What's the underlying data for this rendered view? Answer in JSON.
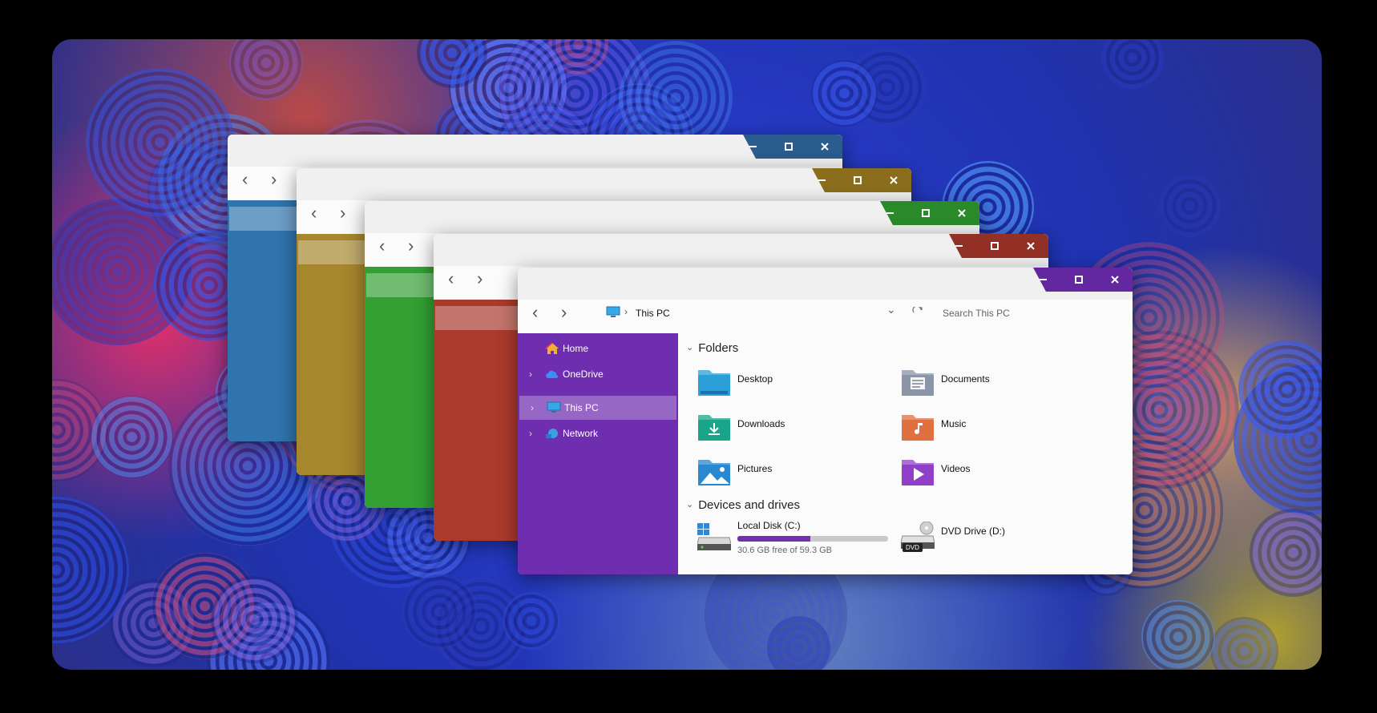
{
  "windows": [
    {
      "id": "blue",
      "accent": "#2f74ae",
      "caption": "#2b5c8f"
    },
    {
      "id": "gold",
      "accent": "#a6872e",
      "caption": "#8a6e1e"
    },
    {
      "id": "green",
      "accent": "#33a033",
      "caption": "#2a8a2a"
    },
    {
      "id": "red",
      "accent": "#a93a2c",
      "caption": "#933026"
    },
    {
      "id": "purple",
      "accent": "#6f2db0",
      "caption": "#63279f"
    }
  ],
  "caption_icons": [
    "minimize-icon",
    "maximize-icon",
    "close-icon"
  ],
  "front": {
    "address": {
      "location": "This PC",
      "chevron": "›",
      "icon": "monitor-icon"
    },
    "search": {
      "placeholder": "Search This PC",
      "icon": "refresh-icon"
    },
    "nav": {
      "back": "‹",
      "forward": "›",
      "dropdown": "⌄"
    },
    "sidebar": {
      "items": [
        {
          "label": "Home",
          "icon": "home-icon",
          "expandable": false,
          "selected": false
        },
        {
          "label": "OneDrive",
          "icon": "cloud-icon",
          "expandable": true,
          "selected": false
        },
        {
          "label": "This PC",
          "icon": "monitor-icon",
          "expandable": true,
          "selected": true
        },
        {
          "label": "Network",
          "icon": "network-icon",
          "expandable": true,
          "selected": false
        }
      ],
      "expand_glyph": "›"
    },
    "folders": {
      "heading": "Folders",
      "items": [
        {
          "label": "Desktop",
          "icon": "desktop-folder-icon",
          "color": "#2a9fd8"
        },
        {
          "label": "Documents",
          "icon": "documents-folder-icon",
          "color": "#8a96a8"
        },
        {
          "label": "Downloads",
          "icon": "downloads-folder-icon",
          "color": "#1aa58a"
        },
        {
          "label": "Music",
          "icon": "music-folder-icon",
          "color": "#e07040"
        },
        {
          "label": "Pictures",
          "icon": "pictures-folder-icon",
          "color": "#2a88d0"
        },
        {
          "label": "Videos",
          "icon": "videos-folder-icon",
          "color": "#9040c8"
        }
      ]
    },
    "drives": {
      "heading": "Devices and drives",
      "items": [
        {
          "label": "Local Disk (C:)",
          "icon": "windows-drive-icon",
          "free_text": "30.6 GB free of 59.3 GB",
          "used_fraction": 0.484
        },
        {
          "label": "DVD Drive (D:)",
          "icon": "dvd-drive-icon",
          "badge": "DVD"
        }
      ]
    },
    "section_chevron": "⌄"
  }
}
